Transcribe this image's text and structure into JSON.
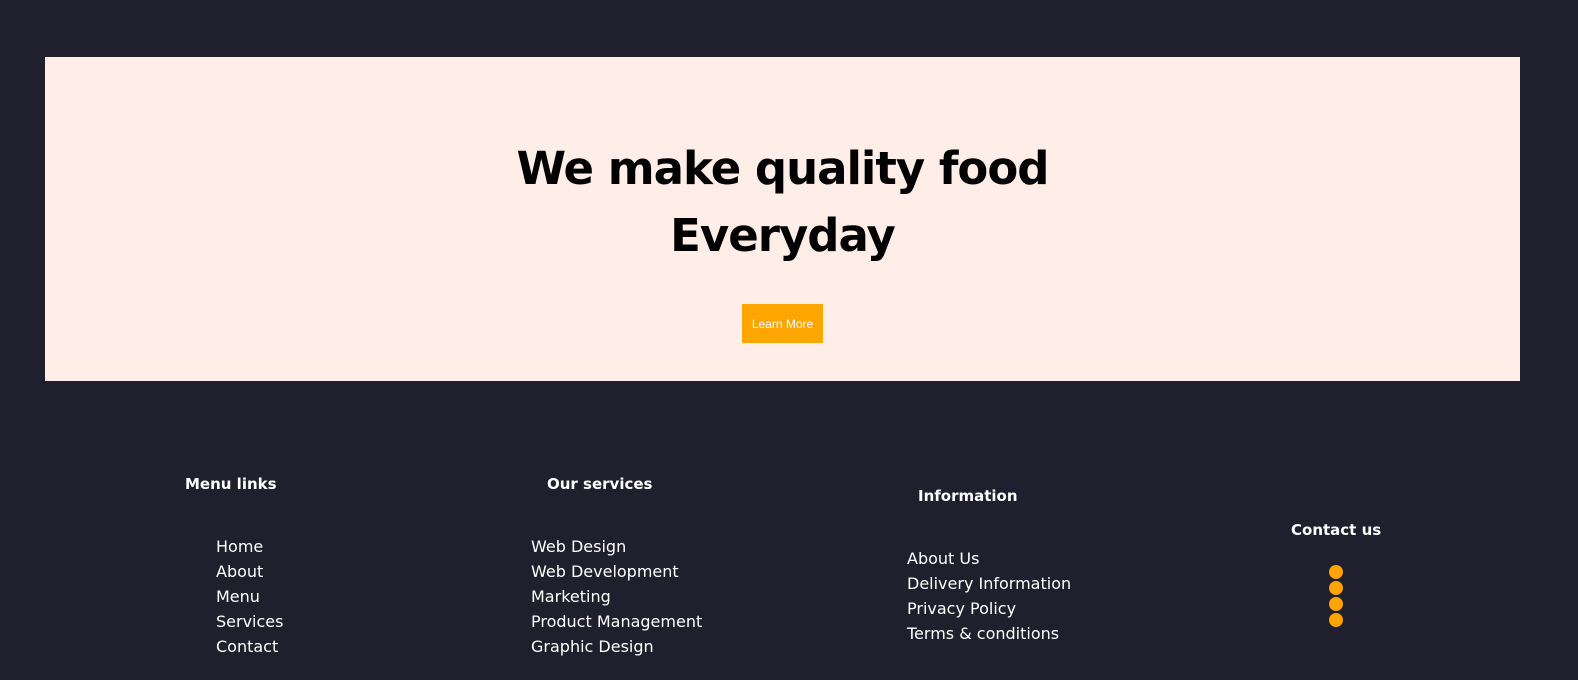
{
  "hero": {
    "title_line1": "We make quality food",
    "title_line2": "Everyday",
    "button_label": "Learn More"
  },
  "footer": {
    "menu_links": {
      "title": "Menu links",
      "items": [
        "Home",
        "About",
        "Menu",
        "Services",
        "Contact"
      ]
    },
    "services": {
      "title": "Our services",
      "items": [
        "Web Design",
        "Web Development",
        "Marketing",
        "Product Management",
        "Graphic Design"
      ]
    },
    "information": {
      "title": "Information",
      "items": [
        "About Us",
        "Delivery Information",
        "Privacy Policy",
        "Terms & conditions"
      ]
    },
    "contact": {
      "title": "Contact us",
      "icons": [
        "social-icon-1",
        "social-icon-2",
        "social-icon-3",
        "social-icon-4"
      ]
    }
  },
  "colors": {
    "background": "#1f1f2d",
    "hero": "#ffeee7",
    "accent": "#ffa500"
  }
}
